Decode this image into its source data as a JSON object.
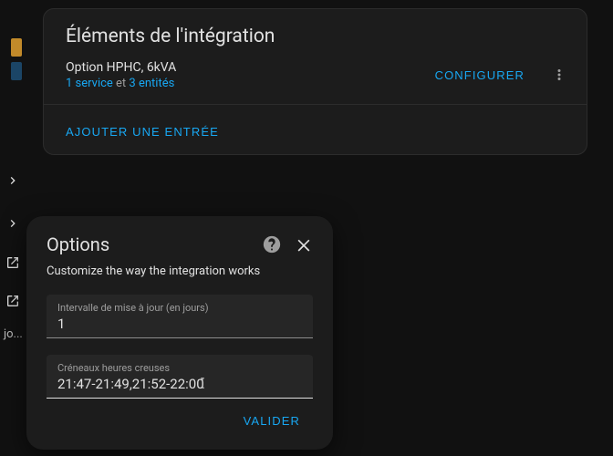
{
  "gutter": {
    "j_text": "jo..."
  },
  "card": {
    "title": "Éléments de l'intégration",
    "entry": {
      "name": "Option HPHC, 6kVA",
      "service_link": "1 service",
      "sep": " et ",
      "entities_link": "3 entités"
    },
    "configure_label": "CONFIGURER",
    "add_entry_label": "AJOUTER UNE ENTRÉE"
  },
  "dialog": {
    "title": "Options",
    "description": "Customize the way the integration works",
    "field1": {
      "label": "Intervalle de mise à jour (en jours)",
      "value": "1"
    },
    "field2": {
      "label": "Créneaux heures creuses",
      "value": "21:47-21:49,21:52-22:00"
    },
    "submit_label": "VALIDER"
  }
}
